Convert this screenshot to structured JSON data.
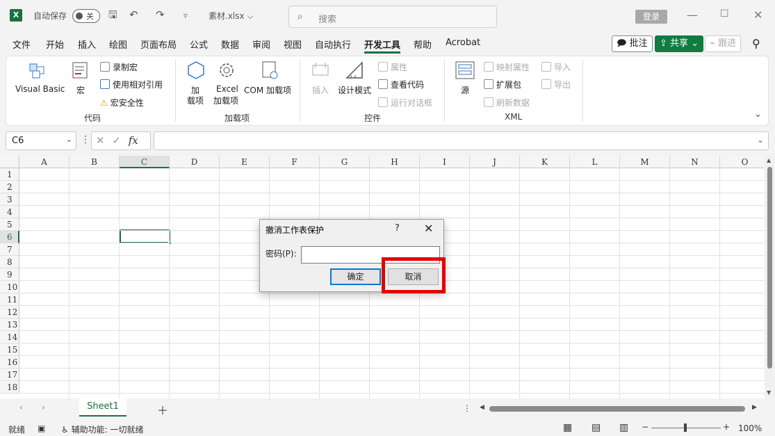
{
  "titlebar": {
    "app_icon": "excel-logo",
    "app_icon_letter": "X",
    "autosave_label": "自动保存",
    "autosave_state": "关",
    "filename": "素材.xlsx",
    "filename_caret": "⌵",
    "search_placeholder": "搜索",
    "login_label": "登录"
  },
  "menu": {
    "items": [
      "文件",
      "开始",
      "插入",
      "绘图",
      "页面布局",
      "公式",
      "数据",
      "审阅",
      "视图",
      "自动执行",
      "开发工具",
      "帮助",
      "Acrobat"
    ],
    "active": "开发工具",
    "comment_label": "批注",
    "share_label": "共享",
    "follow_label": "跟进"
  },
  "ribbon": {
    "code": {
      "group_label": "代码",
      "visual_basic": "Visual Basic",
      "macros": "宏",
      "record_macro": "录制宏",
      "relative_ref": "使用相对引用",
      "macro_security": "宏安全性"
    },
    "addins": {
      "group_label": "加载项",
      "addins_line1": "加",
      "addins_line2": "载项",
      "excel_addins_line1": "Excel",
      "excel_addins_line2": "加载项",
      "com_addins": "COM 加载项"
    },
    "controls": {
      "group_label": "控件",
      "insert": "插入",
      "design_mode": "设计模式",
      "properties": "属性",
      "view_code": "查看代码",
      "run_dialog": "运行对话框"
    },
    "xml": {
      "group_label": "XML",
      "source": "源",
      "map_properties": "映射属性",
      "expansion_packs": "扩展包",
      "refresh_data": "刷新数据",
      "import": "导入",
      "export": "导出"
    }
  },
  "formula_bar": {
    "name_box": "C6",
    "fx_label": "fx"
  },
  "grid": {
    "columns": [
      "A",
      "B",
      "C",
      "D",
      "E",
      "F",
      "G",
      "H",
      "I",
      "J",
      "K",
      "L",
      "M",
      "N",
      "O"
    ],
    "rows": [
      "1",
      "2",
      "3",
      "4",
      "5",
      "6",
      "7",
      "8",
      "9",
      "10",
      "11",
      "12",
      "13",
      "14",
      "15",
      "16",
      "17",
      "18"
    ],
    "selected_column": "C",
    "selected_row": "6"
  },
  "sheet_tabs": {
    "sheets": [
      "Sheet1"
    ],
    "active": "Sheet1"
  },
  "status_bar": {
    "ready": "就绪",
    "accessibility": "辅助功能: 一切就绪",
    "zoom": "100%"
  },
  "dialog": {
    "title": "撤消工作表保护",
    "help": "?",
    "close": "✕",
    "password_label": "密码(P):",
    "password_value": "",
    "ok_label": "确定",
    "cancel_label": "取消",
    "highlight_color": "#e30000"
  }
}
